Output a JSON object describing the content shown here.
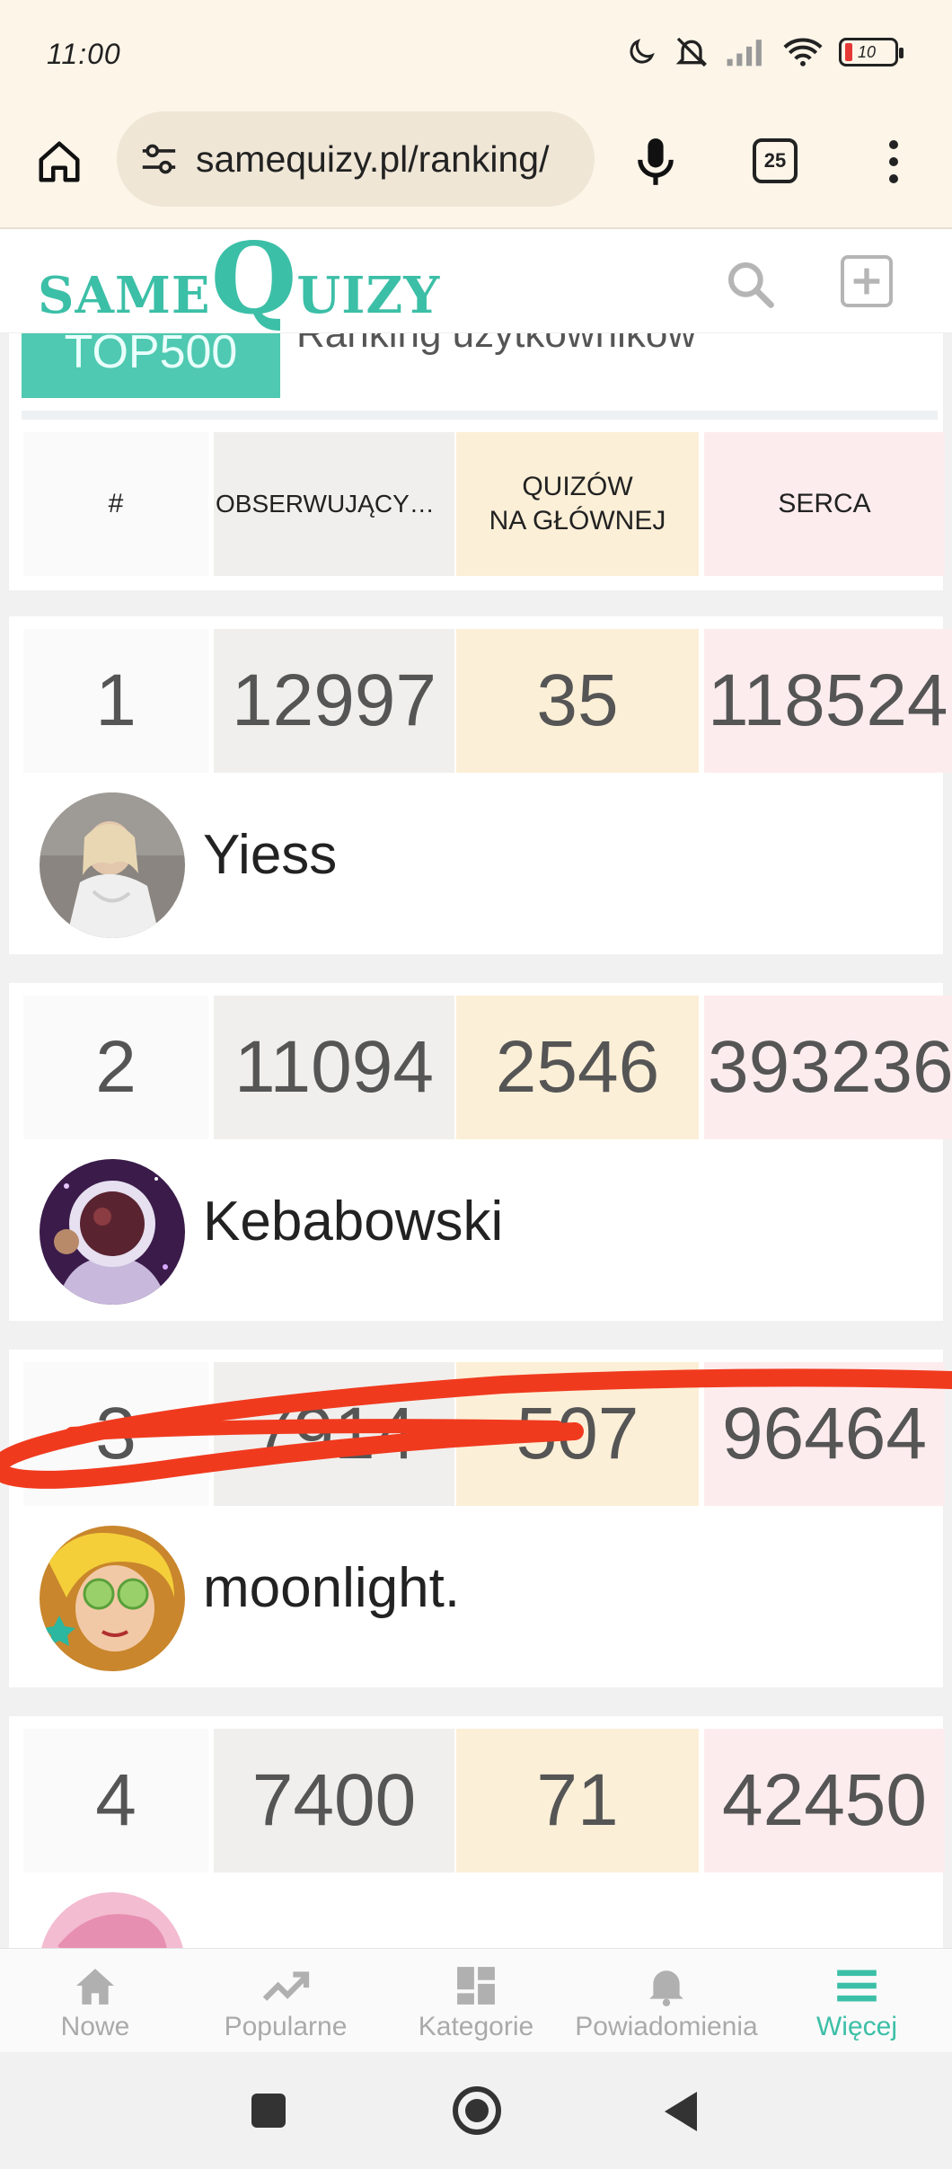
{
  "status_bar": {
    "time": "11:00",
    "battery_level": "10",
    "icons": [
      "moon-icon",
      "silent-bell-icon",
      "signal-icon",
      "wifi-icon",
      "battery-icon"
    ]
  },
  "browser": {
    "url": "samequizy.pl/ranking/",
    "tab_count": "25",
    "icons": [
      "home-icon",
      "site-settings-icon",
      "mic-icon",
      "tabs-icon",
      "more-menu-icon"
    ]
  },
  "site": {
    "logo_same": "SAME",
    "logo_q": "Q",
    "logo_uizy": "UIZY",
    "accent_color": "#3cbfa7"
  },
  "ranking": {
    "badge": "TOP500",
    "title": "Ranking użytkowników",
    "columns": {
      "rank": "#",
      "followers": "OBSERWUJĄCY…",
      "quizzes_line1": "QUIZÓW",
      "quizzes_line2": "NA GŁÓWNEJ",
      "hearts": "SERCA"
    },
    "rows": [
      {
        "rank": "1",
        "followers": "12997",
        "quizzes": "35",
        "hearts": "118524",
        "username": "Yiess"
      },
      {
        "rank": "2",
        "followers": "11094",
        "quizzes": "2546",
        "hearts": "393236",
        "username": "Kebabowski"
      },
      {
        "rank": "3",
        "followers": "7914",
        "quizzes": "507",
        "hearts": "96464",
        "username": "moonlight."
      },
      {
        "rank": "4",
        "followers": "7400",
        "quizzes": "71",
        "hearts": "42450",
        "username": ""
      }
    ]
  },
  "bottom_nav": {
    "items": [
      {
        "label": "Nowe",
        "icon": "home-icon"
      },
      {
        "label": "Popularne",
        "icon": "trending-icon"
      },
      {
        "label": "Kategorie",
        "icon": "grid-icon"
      },
      {
        "label": "Powiadomienia",
        "icon": "bell-icon"
      },
      {
        "label": "Więcej",
        "icon": "menu-icon"
      }
    ],
    "active": "Więcej"
  },
  "annotation_color": "#f03a1e"
}
